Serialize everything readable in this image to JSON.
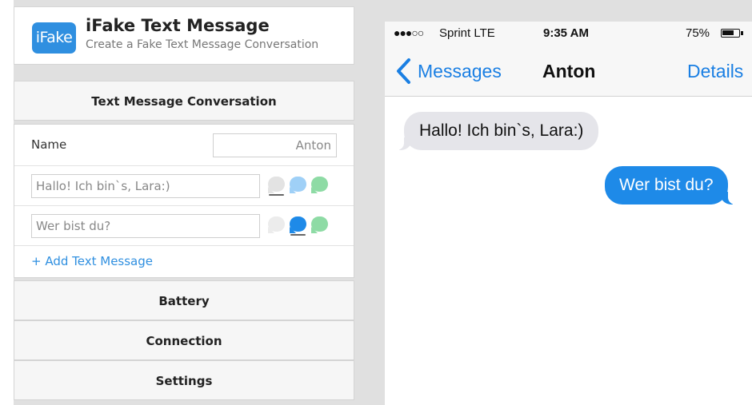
{
  "app": {
    "logo_text": "iFake",
    "title": "iFake Text Message",
    "subtitle": "Create a Fake Text Message Conversation"
  },
  "sections": {
    "conversation": "Text Message Conversation",
    "battery": "Battery",
    "connection": "Connection",
    "settings": "Settings"
  },
  "form": {
    "name_label": "Name",
    "name_value": "Anton",
    "messages": [
      {
        "text": "Hallo! Ich bin`s, Lara:)",
        "selected_style": "gray"
      },
      {
        "text": "Wer bist du?",
        "selected_style": "blue"
      }
    ],
    "add_message": "+ Add Text Message"
  },
  "phone": {
    "status": {
      "signal": "●●●○○",
      "carrier": "Sprint  LTE",
      "time": "9:35 AM",
      "battery": "75%",
      "battery_level": 0.75
    },
    "nav": {
      "back_label": "Messages",
      "contact": "Anton",
      "details": "Details"
    },
    "messages": [
      {
        "text": "Hallo! Ich bin`s, Lara:)",
        "side": "left"
      },
      {
        "text": "Wer bist du?",
        "side": "right"
      }
    ]
  },
  "colors": {
    "accent_blue": "#1e8ae8",
    "received_gray": "#e5e5ea",
    "green": "#8edba5",
    "link_blue": "#2f8fe0"
  },
  "icons": {
    "back": "chevron-left-icon",
    "battery": "battery-icon",
    "signal": "signal-dots-icon",
    "bubble_choices": [
      "gray-bubble-icon",
      "blue-bubble-icon",
      "green-bubble-icon"
    ]
  }
}
